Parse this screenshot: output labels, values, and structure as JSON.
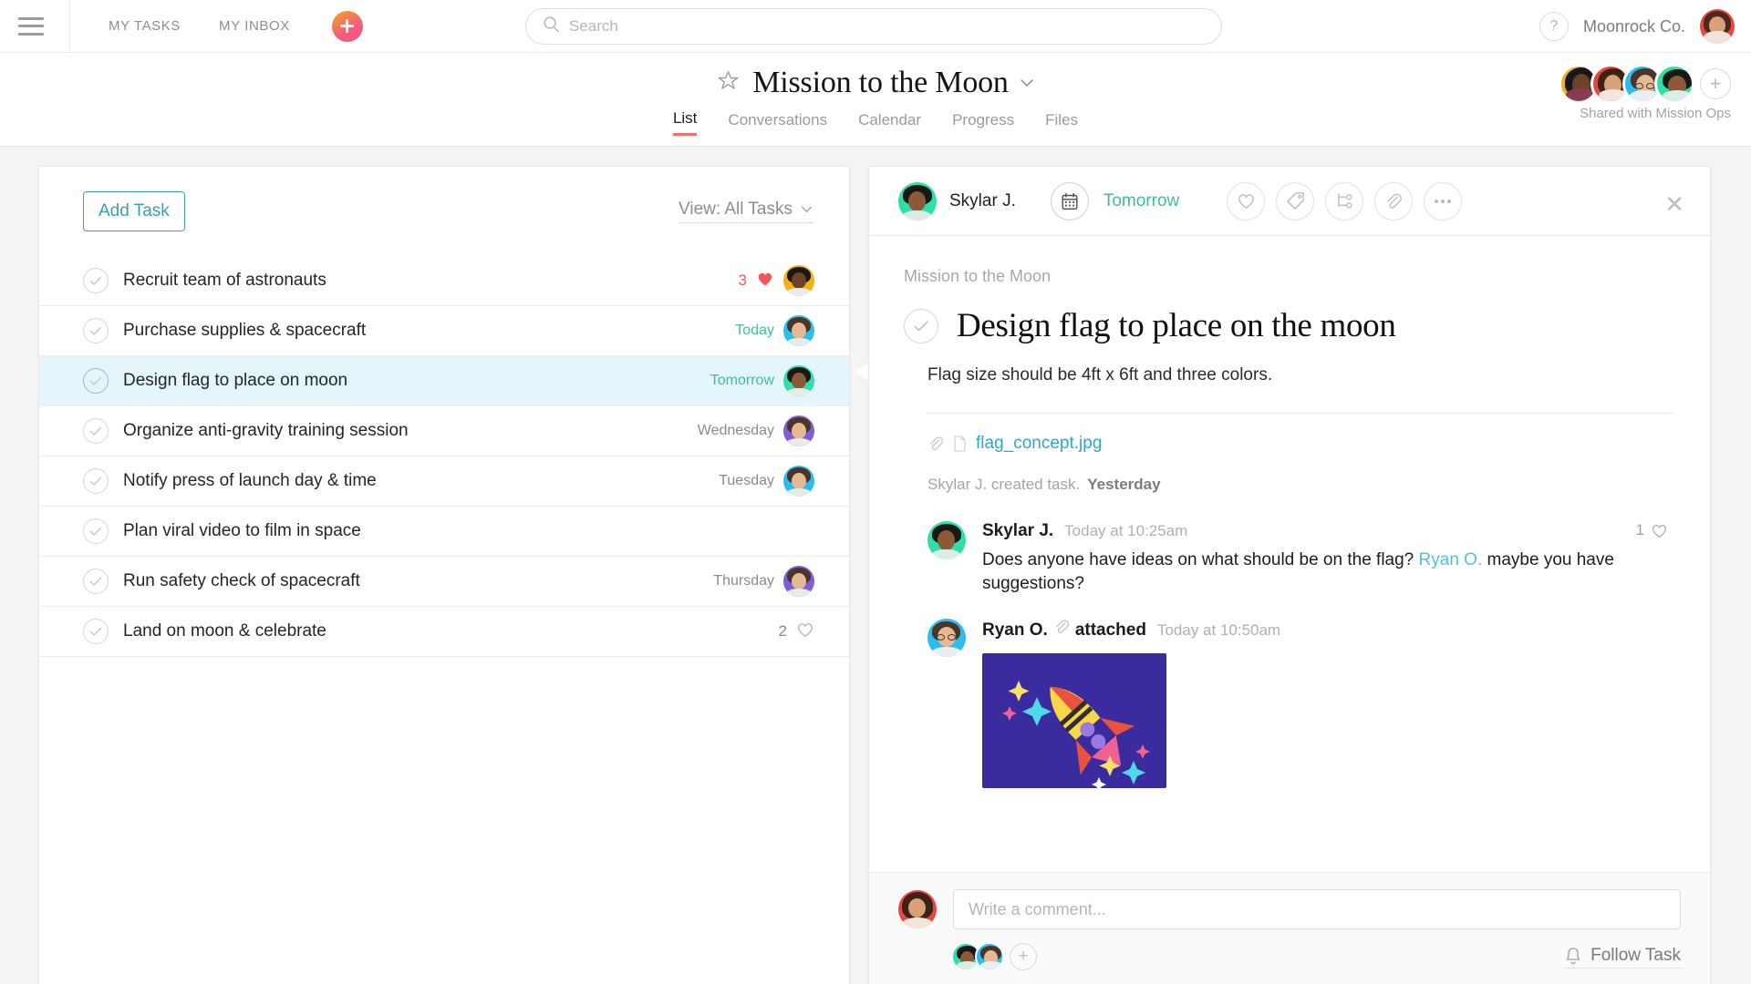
{
  "topbar": {
    "menu_icon": "hamburger-icon",
    "nav": [
      {
        "label": "MY TASKS"
      },
      {
        "label": "MY INBOX"
      }
    ],
    "add_icon": "plus-icon",
    "search": {
      "placeholder": "Search",
      "value": "",
      "icon": "search-icon"
    },
    "help_label": "?",
    "org_name": "Moonrock Co."
  },
  "project": {
    "star_icon": "star-outline-icon",
    "title": "Mission to the Moon",
    "caret_icon": "chevron-down-icon",
    "tabs": [
      {
        "label": "List",
        "active": true
      },
      {
        "label": "Conversations",
        "active": false
      },
      {
        "label": "Calendar",
        "active": false
      },
      {
        "label": "Progress",
        "active": false
      },
      {
        "label": "Files",
        "active": false
      }
    ],
    "shared_with": "Shared with Mission Ops",
    "add_member_icon": "plus-icon",
    "members": [
      {
        "name": "member-1",
        "bg": "#f5b014"
      },
      {
        "name": "member-2",
        "bg": "#e8463f"
      },
      {
        "name": "member-3",
        "bg": "#29bdf0"
      },
      {
        "name": "member-4",
        "bg": "#2ee0a8"
      }
    ]
  },
  "list_panel": {
    "add_task_label": "Add Task",
    "view_label": "View: All Tasks",
    "view_caret": "chevron-down-icon",
    "tasks": [
      {
        "name": "Recruit team of astronauts",
        "due": "",
        "due_soon": false,
        "likes": "3",
        "liked": true,
        "avatar": "#f5b014",
        "has_avatar": true,
        "selected": false
      },
      {
        "name": "Purchase supplies & spacecraft",
        "due": "Today",
        "due_soon": true,
        "likes": "",
        "liked": false,
        "avatar": "#29bdf0",
        "has_avatar": true,
        "selected": false
      },
      {
        "name": "Design flag to place on moon",
        "due": "Tomorrow",
        "due_soon": true,
        "likes": "",
        "liked": false,
        "avatar": "#2ee0a8",
        "has_avatar": true,
        "selected": true
      },
      {
        "name": "Organize anti-gravity training session",
        "due": "Wednesday",
        "due_soon": false,
        "likes": "",
        "liked": false,
        "avatar": "#7b5fd6",
        "has_avatar": true,
        "selected": false
      },
      {
        "name": "Notify press of launch day & time",
        "due": "Tuesday",
        "due_soon": false,
        "likes": "",
        "liked": false,
        "avatar": "#29bdf0",
        "has_avatar": true,
        "selected": false
      },
      {
        "name": "Plan viral video to film in space",
        "due": "",
        "due_soon": false,
        "likes": "",
        "liked": false,
        "avatar": "",
        "has_avatar": false,
        "selected": false
      },
      {
        "name": "Run safety check of spacecraft",
        "due": "Thursday",
        "due_soon": false,
        "likes": "",
        "liked": false,
        "avatar": "#7b5fd6",
        "has_avatar": true,
        "selected": false
      },
      {
        "name": "Land on moon & celebrate",
        "due": "",
        "due_soon": false,
        "likes": "2",
        "liked": false,
        "avatar": "",
        "has_avatar": false,
        "selected": false
      }
    ]
  },
  "detail": {
    "assignee": "Skylar J.",
    "assignee_avatar_bg": "#2ee0a8",
    "calendar_icon": "calendar-icon",
    "due_date": "Tomorrow",
    "actions": [
      {
        "name": "like-task-button",
        "icon": "heart-icon"
      },
      {
        "name": "add-tag-button",
        "icon": "tag-icon"
      },
      {
        "name": "add-subtask-button",
        "icon": "subtask-icon"
      },
      {
        "name": "attach-file-button",
        "icon": "paperclip-icon"
      },
      {
        "name": "more-options-button",
        "icon": "ellipsis-icon"
      }
    ],
    "close_icon": "close-icon",
    "breadcrumb": "Mission to the Moon",
    "title": "Design flag to place on the moon",
    "description": "Flag size should be 4ft x 6ft and three colors.",
    "attachment": {
      "icon": "paperclip-icon",
      "file_icon": "file-icon",
      "name": "flag_concept.jpg"
    },
    "activity": {
      "text": "Skylar J. created task.",
      "time": "Yesterday"
    },
    "comments": [
      {
        "author": "Skylar J.",
        "avatar_bg": "#2ee0a8",
        "time": "Today at 10:25am",
        "text_before": "Does anyone have ideas on what should be on the flag? ",
        "mention": "Ryan O.",
        "text_after": " maybe you have suggestions?",
        "like_count": "1",
        "like_icon": "heart-outline-icon",
        "type": "text"
      },
      {
        "author": "Ryan O.",
        "avatar_bg": "#29bdf0",
        "attach_icon": "paperclip-icon",
        "attached_label": "attached",
        "time": "Today at 10:50am",
        "type": "image",
        "image_alt": "rocket-illustration"
      }
    ],
    "composer": {
      "avatar_bg": "#e8463f",
      "placeholder": "Write a comment...",
      "value": "",
      "followers": [
        {
          "bg": "#2ee0a8"
        },
        {
          "bg": "#29bdf0"
        }
      ],
      "add_follower_icon": "plus-icon",
      "follow_label": "Follow Task",
      "follow_icon": "bell-icon"
    }
  },
  "colors": {
    "accent_teal": "#3aa0ad",
    "due_green": "#3fbd9a",
    "like_red": "#f2585b",
    "tab_underline": "#f36d6d",
    "link_blue": "#2aa8c4",
    "selected_row": "#e4f6fb"
  }
}
